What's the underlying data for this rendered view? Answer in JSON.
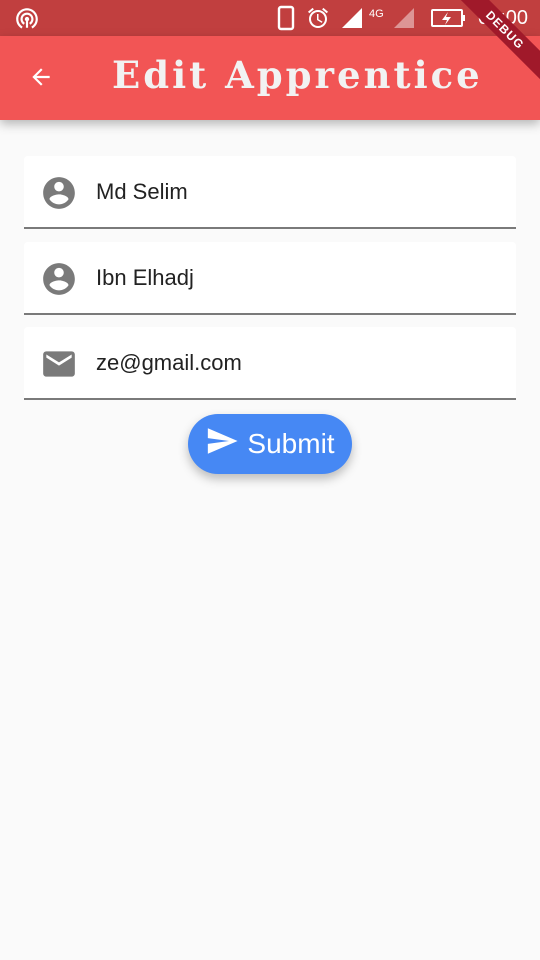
{
  "status_bar": {
    "time": "04:00",
    "network": "4G",
    "icons": [
      "hotspot-icon",
      "phone-icon",
      "alarm-icon",
      "signal-icon",
      "signal-secondary-icon",
      "battery-charging-icon"
    ]
  },
  "app_bar": {
    "title": "Edit Apprentice",
    "back_icon": "arrow-back-icon",
    "color": "#f25555"
  },
  "debug_banner": "DEBUG",
  "form": {
    "first_name": {
      "value": "Md Selim",
      "icon": "account-circle-icon"
    },
    "last_name": {
      "value": "Ibn Elhadj",
      "icon": "account-circle-icon"
    },
    "email": {
      "value": "ze@gmail.com",
      "icon": "email-icon"
    }
  },
  "submit": {
    "label": "Submit",
    "icon": "send-icon",
    "color": "#4688f4"
  }
}
